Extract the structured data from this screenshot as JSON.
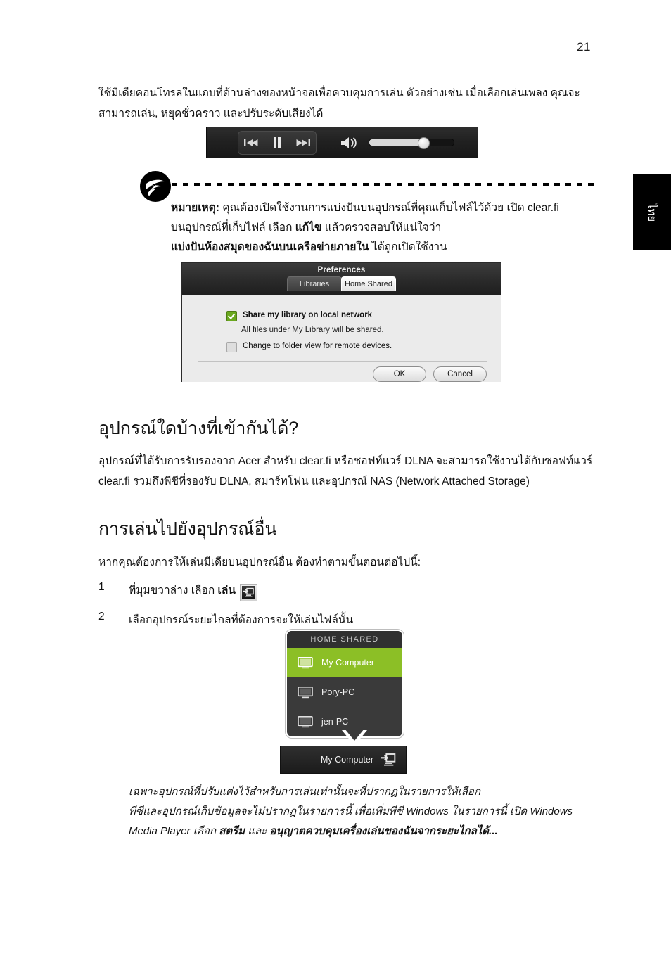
{
  "page": {
    "number": "21",
    "side_tab_label": "ไทย"
  },
  "intro": {
    "paragraph": "ใช้มีเดียคอนโทรลในแถบที่ด้านล่างของหน้าจอเพื่อควบคุมการเล่น ตัวอย่างเช่น เมื่อเลือกเล่นเพลง คุณจะสามารถเล่น, หยุดชั่วคราว และปรับระดับเสียงได้"
  },
  "player": {
    "previous_label": "previous-track",
    "pause_label": "pause",
    "next_label": "next-track",
    "volume_label": "volume",
    "volume_percent": 63
  },
  "note": {
    "logo_label": "acer-logo",
    "line1_bold": "หมายเหตุ:",
    "line1_rest": " คุณต้องเปิดใช้งานการแบ่งปันบนอุปกรณ์ที่คุณเก็บไฟล์ไว้ด้วย เปิด clear.fi",
    "line2_pre": "บนอุปกรณ์ที่เก็บไฟล์ เลือก ",
    "line2_bold": "แก้ไข",
    "line2_post": " แล้วตรวจสอบให้แน่ใจว่า",
    "line3_bold": "แบ่งปันห้องสมุดของฉันบนเครือข่ายภายใน",
    "line3_post": " ได้ถูกเปิดใช้งาน"
  },
  "prefs_dialog": {
    "title": "Preferences",
    "tabs": [
      {
        "label": "Libraries",
        "active": false
      },
      {
        "label": "Home Shared",
        "active": true
      }
    ],
    "share_checkbox_label": "Share my library on local network",
    "share_checkbox_checked": true,
    "share_sub_label": "All files under My Library will be shared.",
    "folder_checkbox_label": "Change to folder view for remote devices.",
    "folder_checkbox_checked": false,
    "ok_label": "OK",
    "cancel_label": "Cancel"
  },
  "section_compat": {
    "heading": "อุปกรณ์ใดบ้างที่เข้ากันได้?",
    "paragraph": "อุปกรณ์ที่ได้รับการรับรองจาก Acer สำหรับ clear.fi หรือซอฟท์แวร์ DLNA จะสามารถใช้งานได้กับซอฟท์แวร์ clear.fi รวมถึงพีซีที่รองรับ DLNA, สมาร์ทโฟน และอุปกรณ์ NAS (Network Attached Storage)"
  },
  "section_playto": {
    "heading": "การเล่นไปยังอุปกรณ์อื่น",
    "intro": "หากคุณต้องการให้เล่นมีเดียบนอุปกรณ์อื่น ต้องทำตามขั้นตอนต่อไปนี้:",
    "steps": [
      {
        "number": "1",
        "text_pre": "ที่มุมขวาล่าง เลือก ",
        "text_bold": "เล่น",
        "icon": "play-to-device-icon"
      },
      {
        "number": "2",
        "text_pre": "เลือกอุปกรณ์ระยะไกลที่ต้องการจะให้เล่นไฟล์นั้น",
        "text_bold": "",
        "icon": ""
      }
    ]
  },
  "home_shared": {
    "title": "HOME SHARED",
    "devices": [
      {
        "name": "My Computer",
        "selected": true
      },
      {
        "name": "Pory-PC",
        "selected": false
      },
      {
        "name": "jen-PC",
        "selected": false
      }
    ],
    "bar_label": "My Computer",
    "bar_icon": "play-to-device-icon",
    "accent_color": "#8cbf26"
  },
  "footnote": {
    "line1": "เฉพาะอุปกรณ์ที่ปรับแต่งไว้สำหรับการเล่นเท่านั้นจะที่ปรากฏในรายการให้เลือก",
    "line2": "พีซีและอุปกรณ์เก็บข้อมูลจะไม่ปรากฏในรายการนี้ เพื่อเพิ่มพีซี Windows ในรายการนี้ เปิด Windows",
    "line3_pre": "Media Player เลือก ",
    "line3_bold1": "สตรีม",
    "line3_mid": " และ ",
    "line3_bold2": "อนุญาตควบคุมเครื่องเล่นของฉันจากระยะไกลได้...",
    "line3_post": ""
  }
}
